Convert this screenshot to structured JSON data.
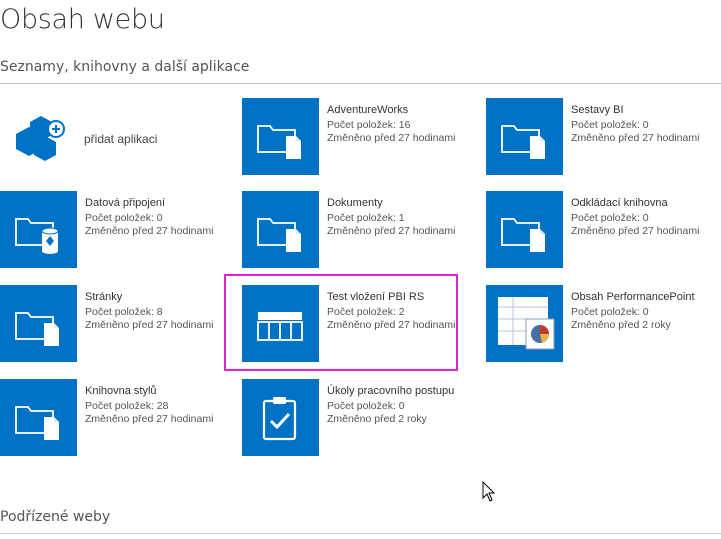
{
  "page": {
    "title": "Obsah webu",
    "apps_heading": "Seznamy, knihovny a další aplikace",
    "subsites_heading": "Podřízené weby"
  },
  "add_app": {
    "label": "přidat aplikaci",
    "icon": "add-app-icon"
  },
  "tiles": [
    {
      "name": "AdventureWorks",
      "count": "Počet položek: 16",
      "modified": "Změněno před 27 hodinami",
      "icon": "document-library-icon"
    },
    {
      "name": "Sestavy BI",
      "count": "Počet položek: 0",
      "modified": "Změněno před 27 hodinami",
      "icon": "document-library-icon"
    },
    {
      "name": "Datová připojení",
      "count": "Počet položek: 0",
      "modified": "Změněno před 27 hodinami",
      "icon": "data-connection-library-icon"
    },
    {
      "name": "Dokumenty",
      "count": "Počet položek: 1",
      "modified": "Změněno před 27 hodinami",
      "icon": "document-library-icon"
    },
    {
      "name": "Odkládací knihovna",
      "count": "Počet položek: 0",
      "modified": "Změněno před 27 hodinami",
      "icon": "document-library-icon"
    },
    {
      "name": "Stránky",
      "count": "Počet položek: 8",
      "modified": "Změněno před 27 hodinami",
      "icon": "document-library-icon"
    },
    {
      "name": "Test vložení PBI RS",
      "count": "Počet položek: 2",
      "modified": "Změněno před 27 hodinami",
      "icon": "custom-list-icon"
    },
    {
      "name": "Obsah PerformancePoint",
      "count": "Počet položek: 0",
      "modified": "Změněno před 2 roky",
      "icon": "performancepoint-content-icon"
    },
    {
      "name": "Knihovna stylů",
      "count": "Počet položek: 28",
      "modified": "Změněno před 27 hodinami",
      "icon": "document-library-icon"
    },
    {
      "name": "Úkoly pracovního postupu",
      "count": "Počet položek: 0",
      "modified": "Změněno před 2 roky",
      "icon": "task-list-icon"
    }
  ],
  "colors": {
    "tile_blue": "#0072c6",
    "highlight": "#e31ed5"
  }
}
